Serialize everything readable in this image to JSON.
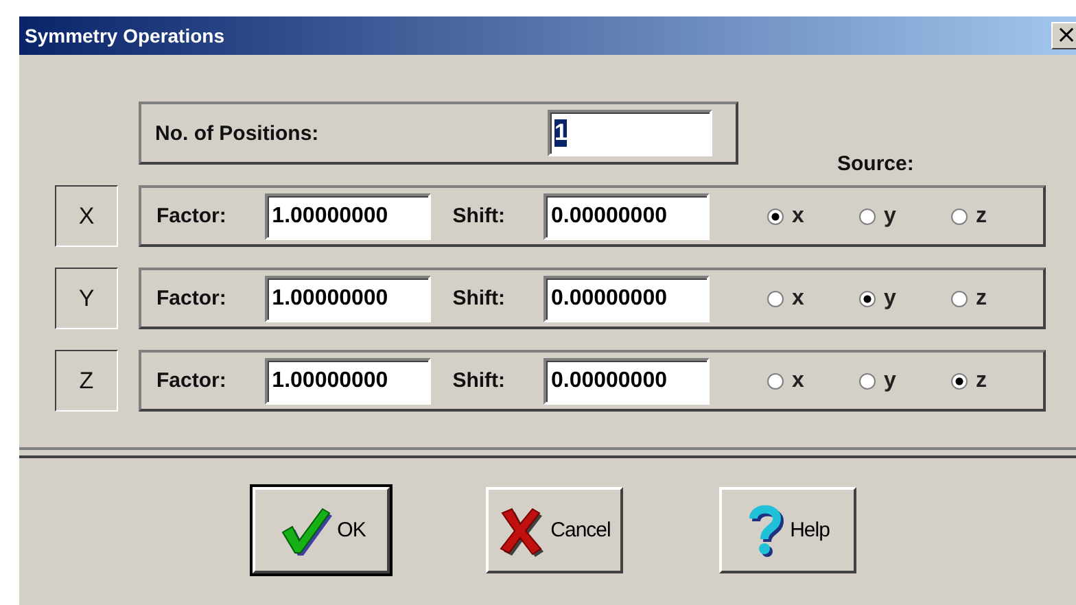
{
  "window": {
    "title": "Symmetry Operations",
    "close": "×"
  },
  "positions": {
    "label": "No. of Positions:",
    "value": "1",
    "value_selected": true
  },
  "source_label": "Source:",
  "rows": [
    {
      "axis": "X",
      "factor_label": "Factor:",
      "factor": "1.00000000",
      "shift_label": "Shift:",
      "shift": "0.00000000",
      "options": [
        {
          "label": "x",
          "selected": true
        },
        {
          "label": "y",
          "selected": false
        },
        {
          "label": "z",
          "selected": false
        }
      ]
    },
    {
      "axis": "Y",
      "factor_label": "Factor:",
      "factor": "1.00000000",
      "shift_label": "Shift:",
      "shift": "0.00000000",
      "options": [
        {
          "label": "x",
          "selected": false
        },
        {
          "label": "y",
          "selected": true
        },
        {
          "label": "z",
          "selected": false
        }
      ]
    },
    {
      "axis": "Z",
      "factor_label": "Factor:",
      "factor": "1.00000000",
      "shift_label": "Shift:",
      "shift": "0.00000000",
      "options": [
        {
          "label": "x",
          "selected": false
        },
        {
          "label": "y",
          "selected": false
        },
        {
          "label": "z",
          "selected": true
        }
      ]
    }
  ],
  "buttons": [
    {
      "kind": "ok",
      "label": "OK"
    },
    {
      "kind": "cancel",
      "label": "Cancel"
    },
    {
      "kind": "help",
      "label": "Help"
    }
  ]
}
